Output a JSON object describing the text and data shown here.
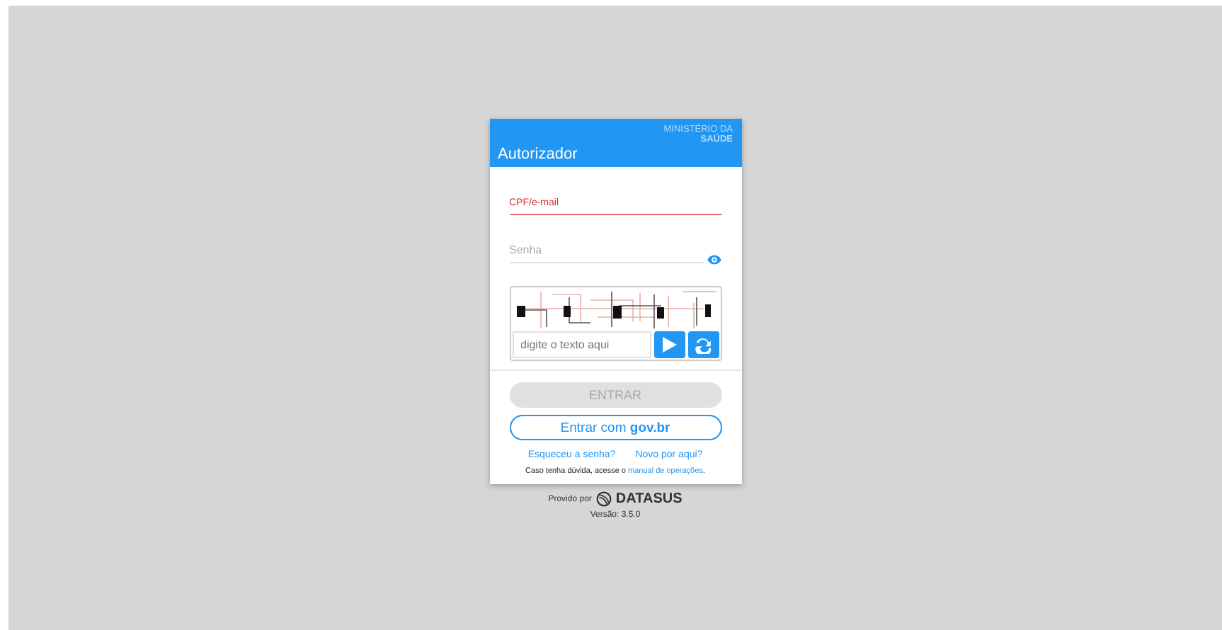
{
  "header": {
    "title": "Autorizador",
    "ministry_line1": "MINISTÉRIO DA",
    "ministry_line2": "SAÚDE"
  },
  "fields": [
    {
      "kind": "text",
      "placeholder": "CPF/e-mail",
      "focused": true
    },
    {
      "kind": "password",
      "placeholder": "Senha",
      "focused": false
    }
  ],
  "captcha": {
    "kind": "picture",
    "placeholder": "digite o texto aqui"
  },
  "submit": {
    "label": "ENTRAR",
    "disabled": true
  },
  "govbr": {
    "label": "Entrar com",
    "brand": "gov.br"
  },
  "links": [
    "Esqueceu a senha?",
    "Novo por aqui?"
  ],
  "help": {
    "text": "Caso tenha dúvida, acesse o",
    "link": "manual de operações",
    "end": "."
  },
  "footer": {
    "provided": "Provido por",
    "logo": "DATASUS",
    "version": "Versão: 3.5.0"
  }
}
